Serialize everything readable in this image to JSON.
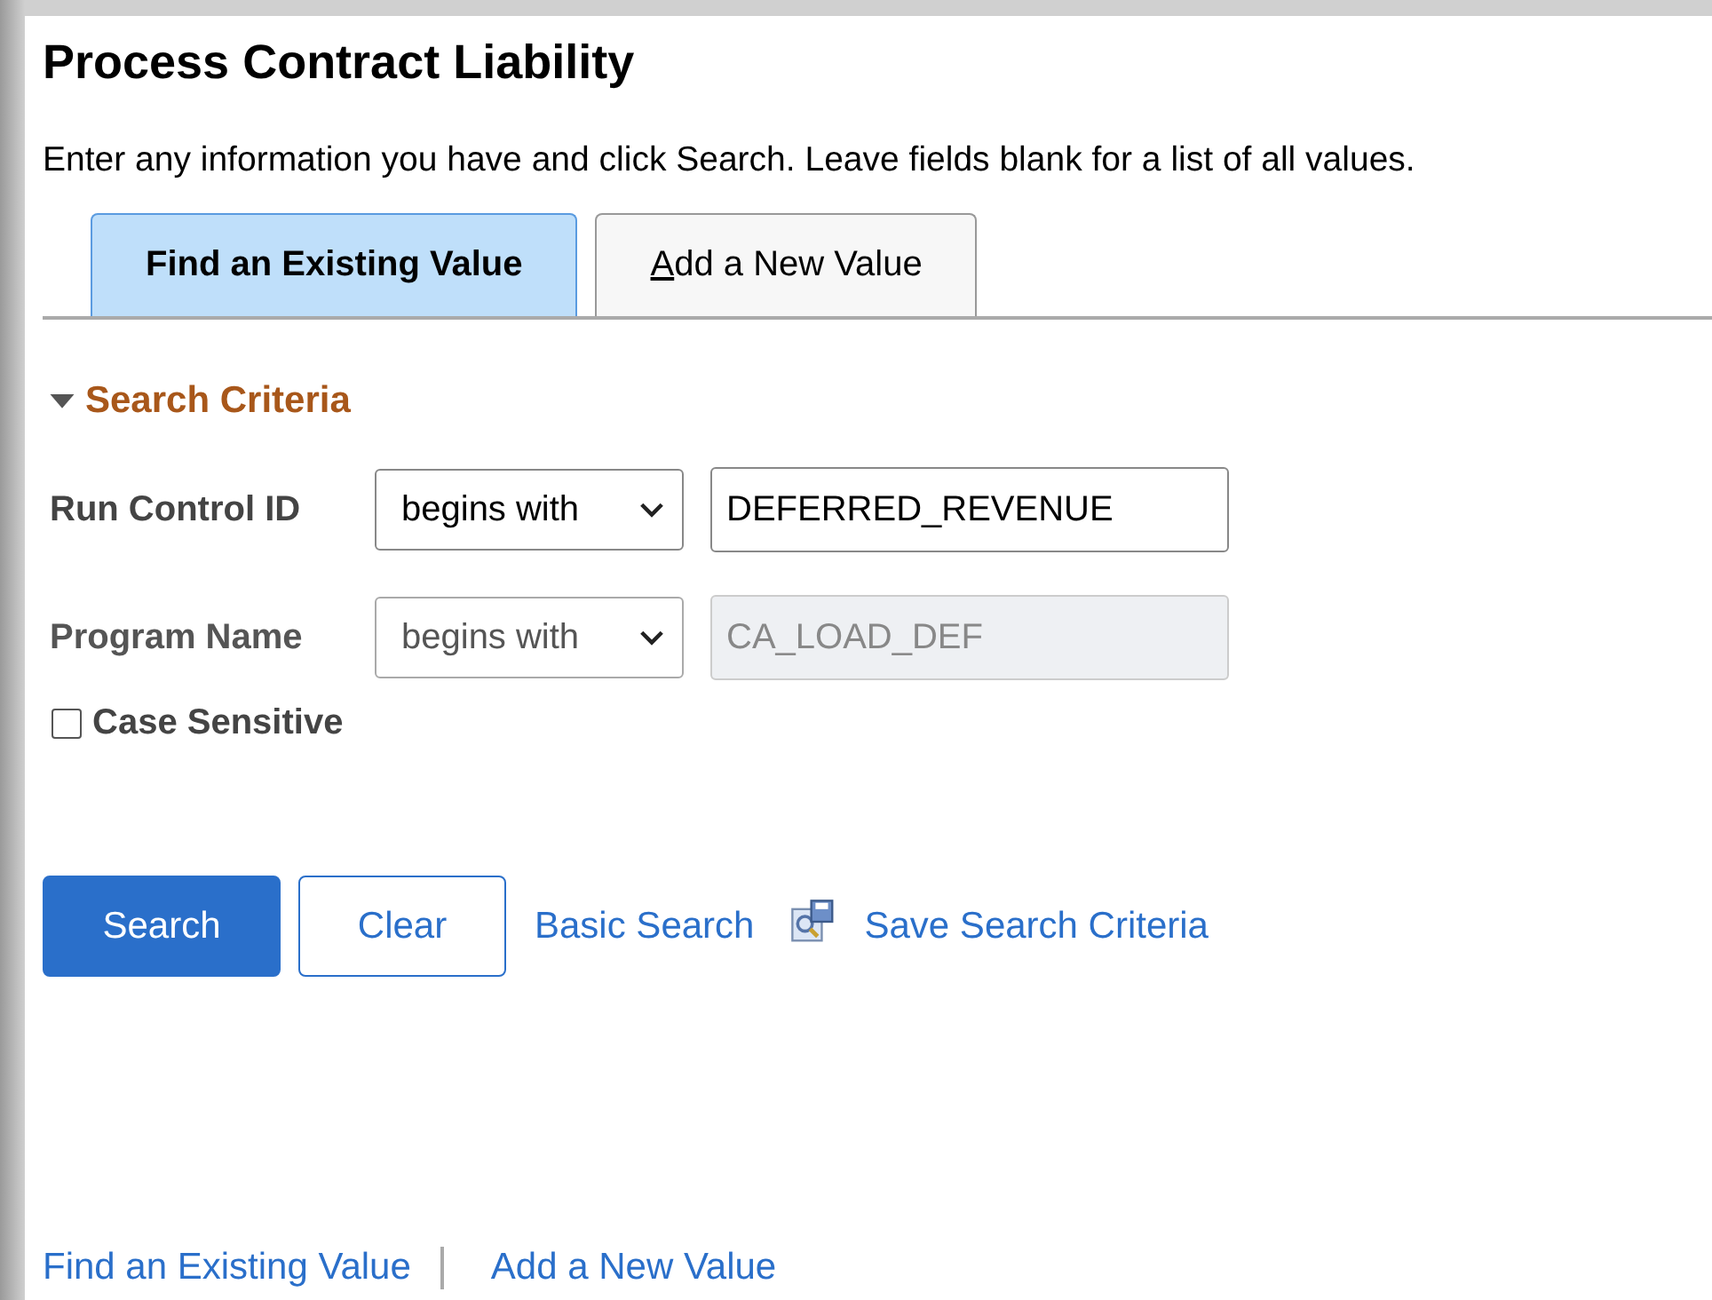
{
  "title": "Process Contract Liability",
  "instructions": "Enter any information you have and click Search. Leave fields blank for a list of all values.",
  "tabs": [
    {
      "label": "Find an Existing Value",
      "selected": true
    },
    {
      "label": "Add a New Value",
      "selected": false
    }
  ],
  "section": {
    "title": "Search Criteria",
    "expanded": true
  },
  "fields": [
    {
      "label": "Run Control ID",
      "operator": "begins with",
      "value": "DEFERRED_REVENUE",
      "disabled": false
    },
    {
      "label": "Program Name",
      "operator": "begins with",
      "value": "CA_LOAD_DEF",
      "disabled": true
    }
  ],
  "case_sensitive": {
    "label": "Case Sensitive",
    "checked": false
  },
  "buttons": [
    {
      "label": "Search",
      "kind": "primary"
    },
    {
      "label": "Clear",
      "kind": "secondary"
    }
  ],
  "links": [
    "Basic Search",
    "Save Search Criteria"
  ],
  "footer_links": [
    "Find an Existing Value",
    "Add a New Value"
  ]
}
